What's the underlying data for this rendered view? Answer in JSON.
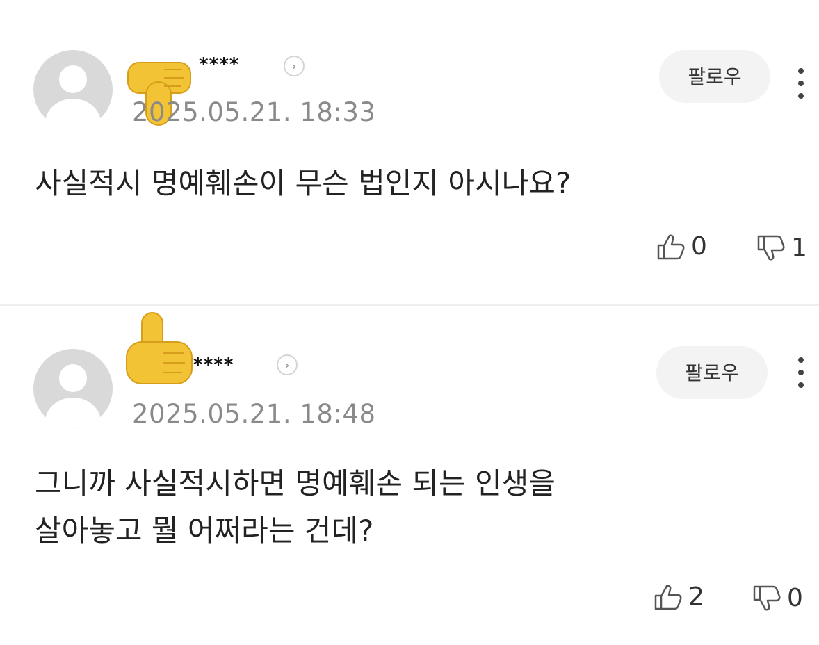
{
  "comments": [
    {
      "username": "****",
      "timestamp": "2025.05.21. 18:33",
      "follow_label": "팔로우",
      "text": "사실적시 명예훼손이 무슨 법인지 아시나요?",
      "likes": "0",
      "dislikes": "1"
    },
    {
      "username": "****",
      "timestamp": "2025.05.21. 18:48",
      "follow_label": "팔로우",
      "text_line1": "그니까 사실적시하면 명예훼손 되는 인생을",
      "text_line2": "살아놓고 뭘 어쩌라는 건데?",
      "likes": "2",
      "dislikes": "0"
    }
  ],
  "icons": {
    "thumbs_down_emoji": "thumbs-down-emoji",
    "thumbs_up_emoji": "thumbs-up-emoji",
    "like": "thumbs-up-outline-icon",
    "dislike": "thumbs-down-outline-icon",
    "more": "vertical-dots-icon",
    "profile_arrow": "chevron-right-icon"
  },
  "colors": {
    "emoji_yellow": "#f2c335",
    "timestamp_gray": "#8a8a8a",
    "follow_bg": "#f3f3f3"
  }
}
